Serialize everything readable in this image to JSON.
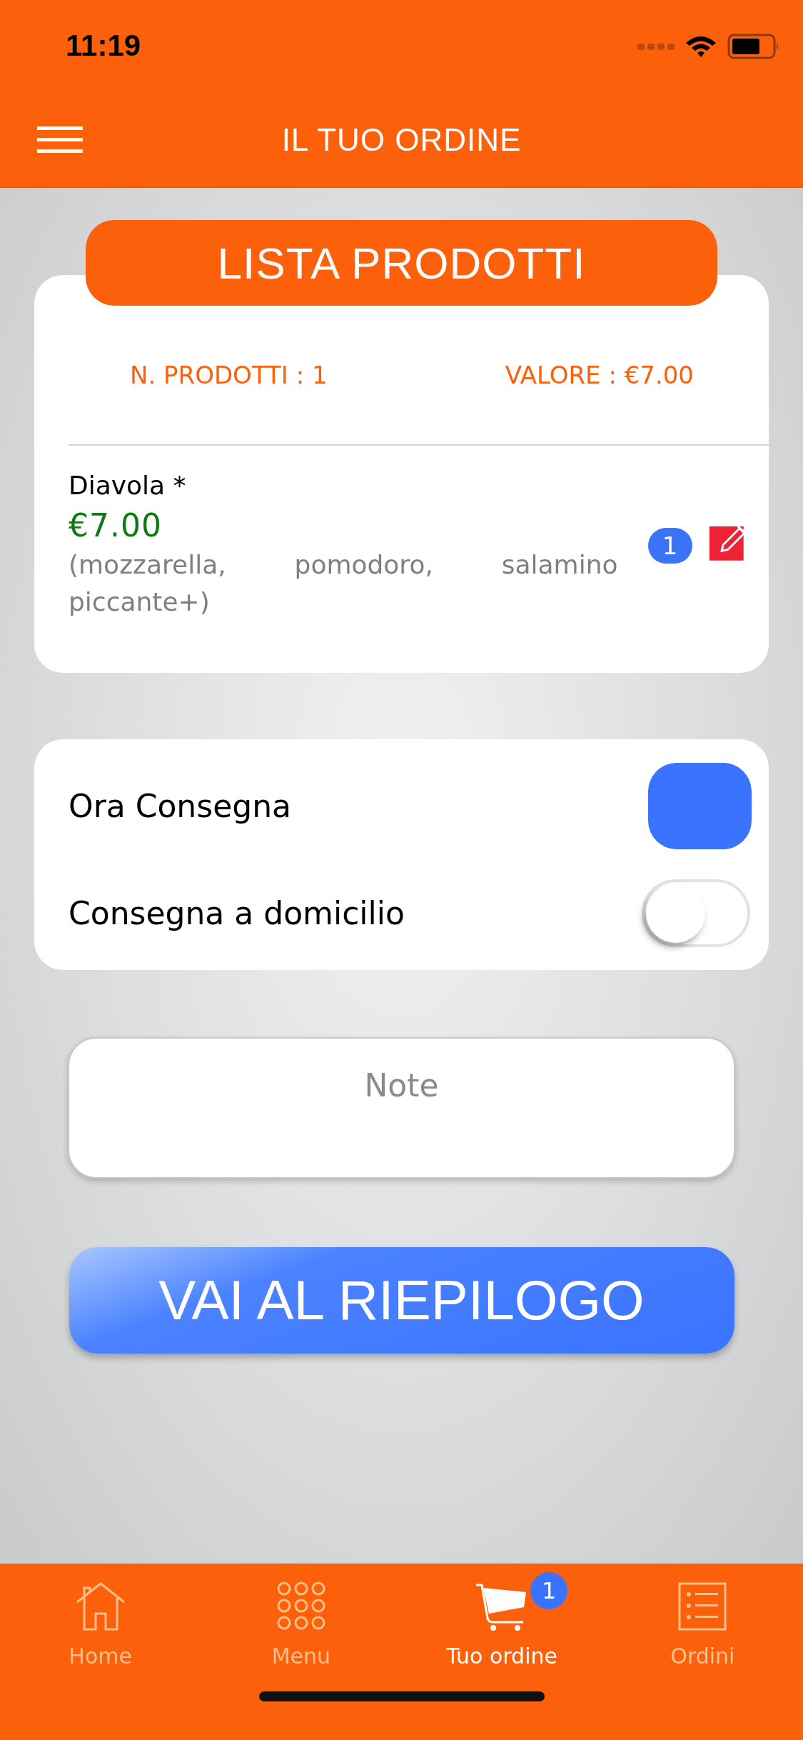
{
  "status_bar": {
    "time": "11:19"
  },
  "nav": {
    "title": "IL TUO ORDINE"
  },
  "products": {
    "title": "LISTA PRODOTTI",
    "count_label": "N. PRODOTTI : 1",
    "value_label": "VALORE : €7.00",
    "items": [
      {
        "name": "Diavola *",
        "price": "€7.00",
        "ingredients": "(mozzarella, pomodoro, salamino piccante+)",
        "quantity": "1"
      }
    ]
  },
  "options": [
    {
      "label": "Ora Consegna",
      "on": true
    },
    {
      "label": "Consegna a domicilio",
      "on": false
    }
  ],
  "note": {
    "placeholder": "Note"
  },
  "primary_button": "VAI AL RIEPILOGO",
  "tabs": [
    {
      "label": "Home",
      "kind": "home",
      "selected": false
    },
    {
      "label": "Menu",
      "kind": "grid",
      "selected": false
    },
    {
      "label": "Tuo ordine",
      "kind": "cart",
      "selected": true,
      "badge": "1"
    },
    {
      "label": "Ordini",
      "kind": "list",
      "selected": false
    }
  ]
}
